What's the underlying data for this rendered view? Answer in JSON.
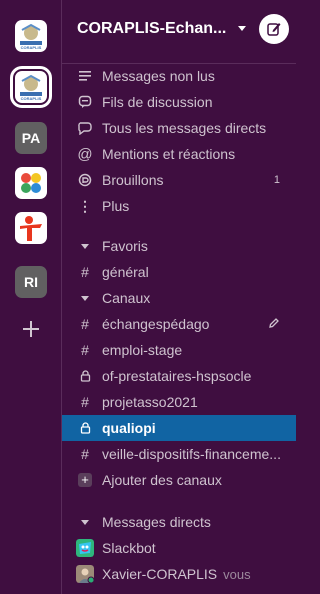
{
  "workspaces": [
    {
      "kind": "logo",
      "label": "CORAPLIS"
    },
    {
      "kind": "logo",
      "label": "CORAPLIS",
      "active": true
    },
    {
      "kind": "initials",
      "label": "PA"
    },
    {
      "kind": "logo",
      "label": ""
    },
    {
      "kind": "logo",
      "label": ""
    },
    {
      "kind": "initials",
      "label": "RI"
    }
  ],
  "workspace_name": "CORAPLIS-Echan...",
  "top_items": [
    {
      "icon": "messages-unread-icon",
      "label": "Messages non lus"
    },
    {
      "icon": "threads-icon",
      "label": "Fils de discussion"
    },
    {
      "icon": "direct-messages-icon",
      "label": "Tous les messages directs"
    },
    {
      "icon": "mentions-icon",
      "label": "Mentions et réactions"
    },
    {
      "icon": "drafts-icon",
      "label": "Brouillons",
      "count": "1"
    },
    {
      "icon": "more-icon",
      "label": "Plus"
    }
  ],
  "favoris": {
    "title": "Favoris",
    "channels": [
      {
        "label": "général",
        "type": "public"
      }
    ]
  },
  "canaux": {
    "title": "Canaux",
    "channels": [
      {
        "label": "échangespédago",
        "type": "public"
      },
      {
        "label": "emploi-stage",
        "type": "public"
      },
      {
        "label": "of-prestataires-hspsocle",
        "type": "private"
      },
      {
        "label": "projetasso2021",
        "type": "public"
      },
      {
        "label": "qualiopi",
        "type": "private",
        "selected": true
      },
      {
        "label": "veille-dispositifs-financeme...",
        "type": "public"
      }
    ],
    "add_label": "Ajouter des canaux"
  },
  "messages_directs": {
    "title": "Messages directs",
    "users": [
      {
        "label": "Slackbot"
      },
      {
        "label": "Xavier-CORAPLIS",
        "suffix": "vous"
      }
    ]
  },
  "colors": {
    "sidebar": "#3F0E40",
    "selected": "#1164A3",
    "text": "#CFC3CF"
  }
}
